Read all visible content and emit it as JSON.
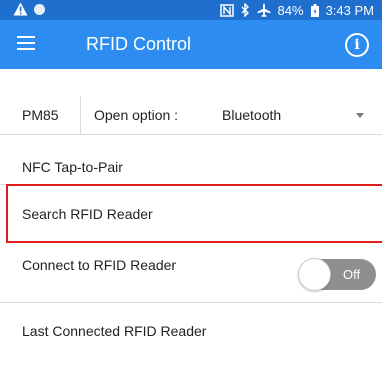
{
  "status_bar": {
    "warning_icon": "warning-icon",
    "battery": "84%",
    "time": "3:43 PM",
    "icons": [
      "nfc-icon",
      "bluetooth-icon",
      "airplane-icon",
      "battery-icon"
    ]
  },
  "app_bar": {
    "title": "RFID Control",
    "menu_icon": "hamburger-menu-icon",
    "info_icon": "info-icon",
    "info_glyph": "i"
  },
  "option_row": {
    "model": "PM85",
    "label": "Open option :",
    "selected": "Bluetooth"
  },
  "items": {
    "nfc": "NFC Tap-to-Pair",
    "search": "Search RFID Reader",
    "connect": "Connect to RFID Reader",
    "last": "Last Connected RFID Reader"
  },
  "toggle": {
    "label": "Off",
    "state": "off"
  },
  "colors": {
    "status_bar": "#1e6fce",
    "app_bar": "#2c8cf0",
    "highlight": "#e11c1c",
    "toggle": "#8f8f8f"
  }
}
